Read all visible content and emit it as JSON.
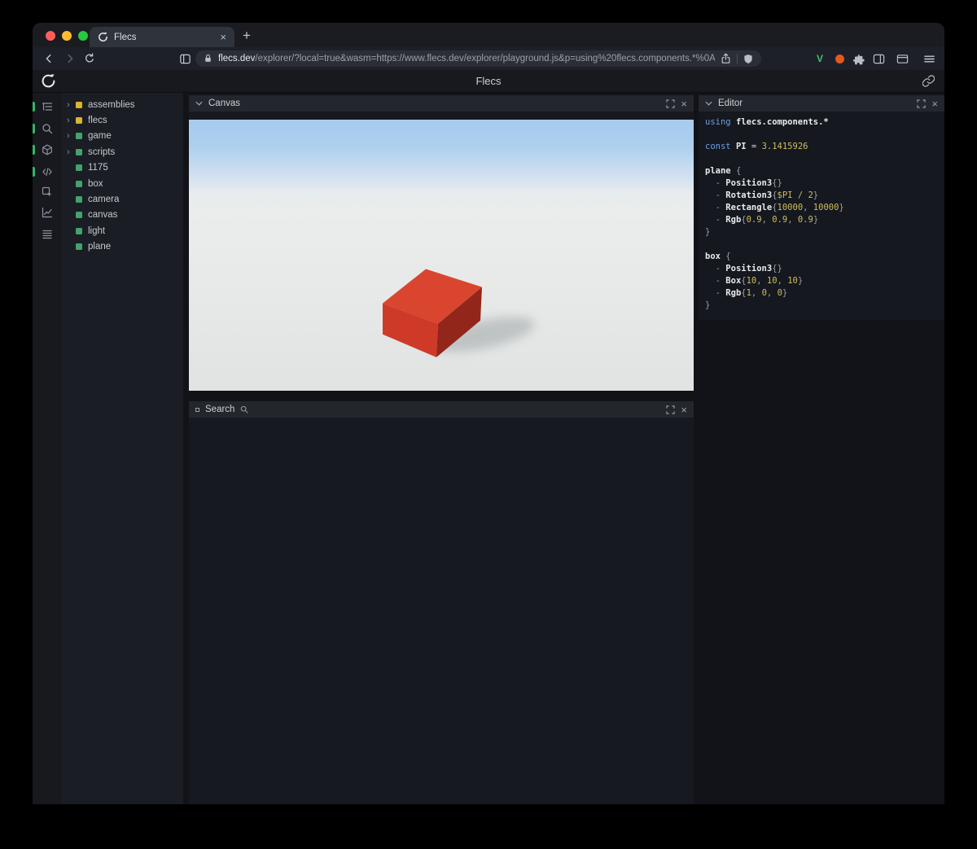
{
  "ui": {
    "close_glyph": "×",
    "new_tab_glyph": "+",
    "tree_expand_glyph": "›"
  },
  "browser": {
    "tab": {
      "title": "Flecs"
    },
    "address": {
      "domain": "flecs.dev",
      "path": "/explorer/?local=true&wasm=https://www.flecs.dev/explorer/playground.js&p=using%20flecs.components.*%0A…"
    }
  },
  "app_header": {
    "title": "Flecs"
  },
  "sidebar": {
    "icons": [
      {
        "name": "entity-tree-icon",
        "active": true
      },
      {
        "name": "search-icon",
        "active": true
      },
      {
        "name": "scene-cube-icon",
        "active": true
      },
      {
        "name": "code-icon",
        "active": true
      },
      {
        "name": "inspect-icon",
        "active": false
      },
      {
        "name": "chart-icon",
        "active": false
      },
      {
        "name": "queries-icon",
        "active": false
      }
    ]
  },
  "tree": {
    "items": [
      {
        "label": "assemblies",
        "color": "#d9b42f",
        "expandable": true
      },
      {
        "label": "flecs",
        "color": "#d9b42f",
        "expandable": true
      },
      {
        "label": "game",
        "color": "#43a368",
        "expandable": true
      },
      {
        "label": "scripts",
        "color": "#43a368",
        "expandable": true
      },
      {
        "label": "1175",
        "color": "#43a368",
        "expandable": false
      },
      {
        "label": "box",
        "color": "#43a368",
        "expandable": false
      },
      {
        "label": "camera",
        "color": "#43a368",
        "expandable": false
      },
      {
        "label": "canvas",
        "color": "#43a368",
        "expandable": false
      },
      {
        "label": "light",
        "color": "#43a368",
        "expandable": false
      },
      {
        "label": "plane",
        "color": "#43a368",
        "expandable": false
      }
    ]
  },
  "panels": {
    "canvas": {
      "title": "Canvas"
    },
    "search": {
      "title": "Search"
    },
    "editor": {
      "title": "Editor",
      "code": [
        [
          [
            "kw",
            "using"
          ],
          [
            "plain",
            " "
          ],
          [
            "id",
            "flecs.components.*"
          ]
        ],
        [],
        [
          [
            "kw",
            "const"
          ],
          [
            "plain",
            " "
          ],
          [
            "id",
            "PI"
          ],
          [
            "plain",
            " = "
          ],
          [
            "num",
            "3.1415926"
          ]
        ],
        [],
        [
          [
            "id",
            "plane"
          ],
          [
            "plain",
            " "
          ],
          [
            "punc",
            "{"
          ]
        ],
        [
          [
            "punc",
            "  - "
          ],
          [
            "id",
            "Position3"
          ],
          [
            "punc",
            "{}"
          ]
        ],
        [
          [
            "punc",
            "  - "
          ],
          [
            "id",
            "Rotation3"
          ],
          [
            "punc",
            "{"
          ],
          [
            "num",
            "$PI / 2"
          ],
          [
            "punc",
            "}"
          ]
        ],
        [
          [
            "punc",
            "  - "
          ],
          [
            "id",
            "Rectangle"
          ],
          [
            "punc",
            "{"
          ],
          [
            "num",
            "10000"
          ],
          [
            "punc",
            ", "
          ],
          [
            "num",
            "10000"
          ],
          [
            "punc",
            "}"
          ]
        ],
        [
          [
            "punc",
            "  - "
          ],
          [
            "id",
            "Rgb"
          ],
          [
            "punc",
            "{"
          ],
          [
            "num",
            "0.9"
          ],
          [
            "punc",
            ", "
          ],
          [
            "num",
            "0.9"
          ],
          [
            "punc",
            ", "
          ],
          [
            "num",
            "0.9"
          ],
          [
            "punc",
            "}"
          ]
        ],
        [
          [
            "punc",
            "}"
          ]
        ],
        [],
        [
          [
            "id",
            "box"
          ],
          [
            "plain",
            " "
          ],
          [
            "punc",
            "{"
          ]
        ],
        [
          [
            "punc",
            "  - "
          ],
          [
            "id",
            "Position3"
          ],
          [
            "punc",
            "{}"
          ]
        ],
        [
          [
            "punc",
            "  - "
          ],
          [
            "id",
            "Box"
          ],
          [
            "punc",
            "{"
          ],
          [
            "num",
            "10"
          ],
          [
            "punc",
            ", "
          ],
          [
            "num",
            "10"
          ],
          [
            "punc",
            ", "
          ],
          [
            "num",
            "10"
          ],
          [
            "punc",
            "}"
          ]
        ],
        [
          [
            "punc",
            "  - "
          ],
          [
            "id",
            "Rgb"
          ],
          [
            "punc",
            "{"
          ],
          [
            "num",
            "1"
          ],
          [
            "punc",
            ", "
          ],
          [
            "num",
            "0"
          ],
          [
            "punc",
            ", "
          ],
          [
            "num",
            "0"
          ],
          [
            "punc",
            "}"
          ]
        ],
        [
          [
            "punc",
            "}"
          ]
        ]
      ]
    }
  },
  "scene": {
    "sky_top": "#a6cbee",
    "ground": "#e8eae9",
    "box_top": "#da452f",
    "box_front": "#cf3a28",
    "box_side": "#93261a",
    "shadow": "#9aa0a2"
  },
  "colors": {
    "accent_green": "#36b469",
    "entity_yellow": "#d9b42f",
    "entity_green": "#43a368",
    "traffic_red": "#ff5f57",
    "traffic_yellow": "#febc2e",
    "traffic_green": "#28c840"
  }
}
